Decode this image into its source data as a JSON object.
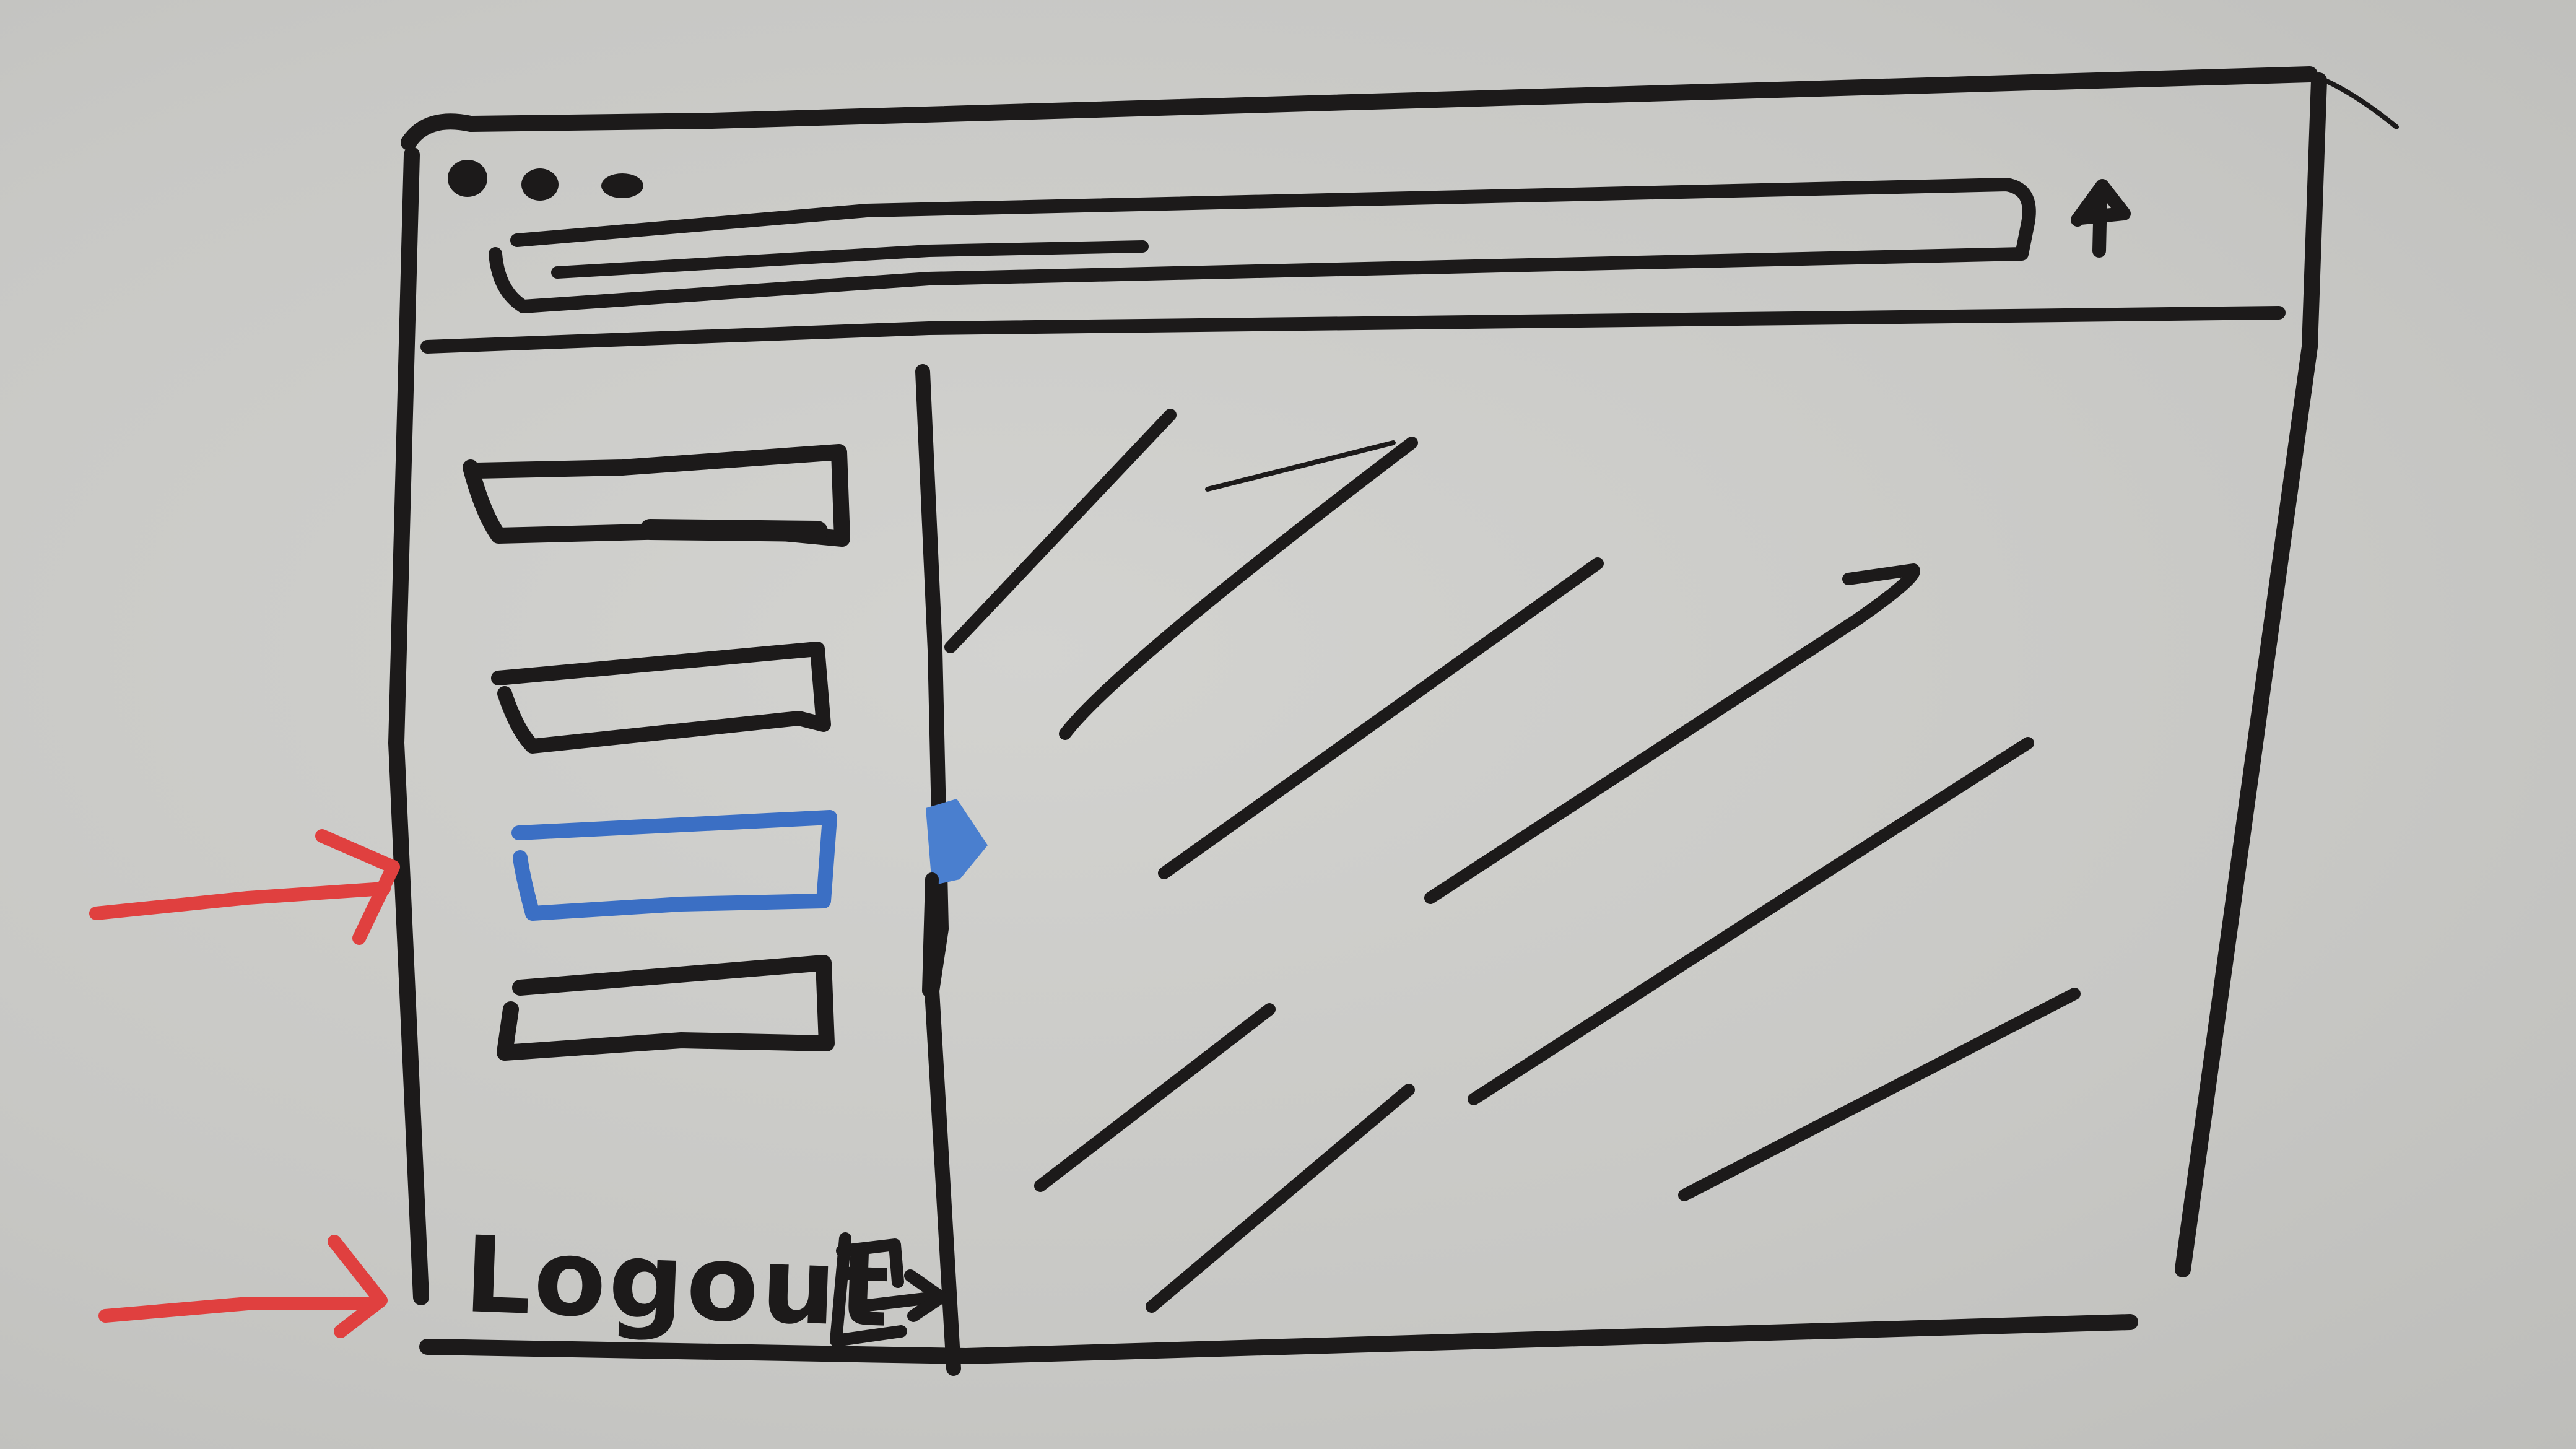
{
  "sidebar": {
    "logout_label": "Logout",
    "logout_icon": "logout-icon",
    "collapse_toggle_icon": "collapse-triangle-icon",
    "items": [
      {
        "state": "normal"
      },
      {
        "state": "normal"
      },
      {
        "state": "selected"
      },
      {
        "state": "normal"
      }
    ]
  },
  "window": {
    "controls": [
      "window-dot-icon",
      "window-dot-icon",
      "window-dot-icon"
    ],
    "upload_icon": "upload-arrow-icon"
  },
  "colors": {
    "marker_black": "#1c1a1a",
    "selected_blue": "#3b6fc4",
    "annotation_red": "#e0403f",
    "board": "#c9c9c6"
  },
  "annotations": [
    {
      "icon": "red-arrow-icon",
      "points_to": "sidebar-item-3"
    },
    {
      "icon": "red-arrow-icon",
      "points_to": "logout-button"
    }
  ]
}
